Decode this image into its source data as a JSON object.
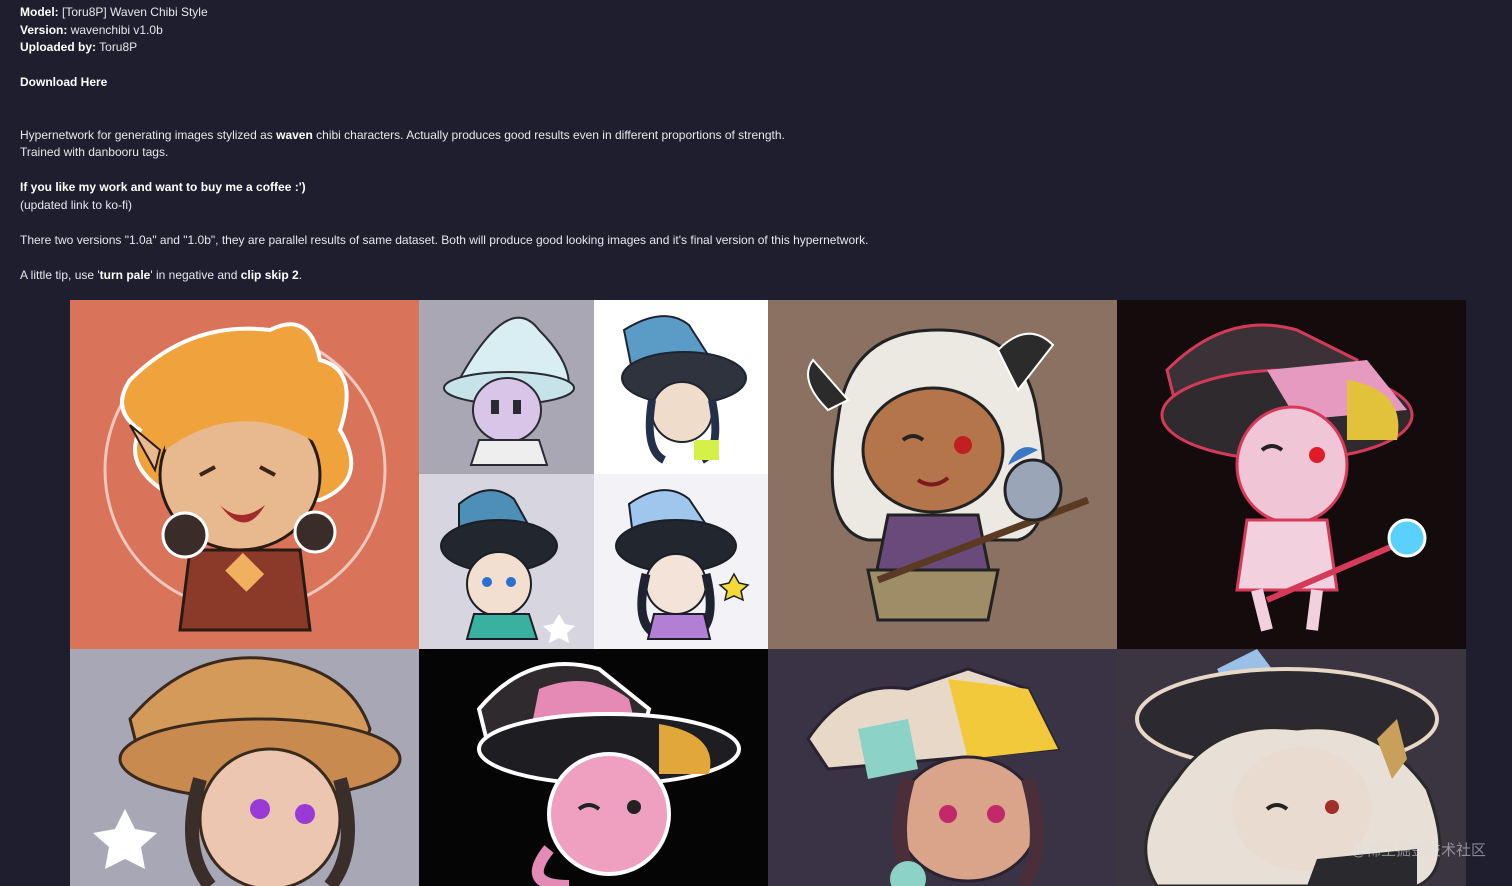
{
  "model": {
    "label": "Model:",
    "value": "[Toru8P] Waven Chibi Style"
  },
  "version": {
    "label": "Version:",
    "value": "wavenchibi v1.0b"
  },
  "uploaded": {
    "label": "Uploaded by:",
    "value": "Toru8P"
  },
  "download_link": "Download Here",
  "description": {
    "part1": "Hypernetwork for generating images stylized as ",
    "bold": "waven",
    "part2": " chibi characters. Actually produces good results even in different proportions of strength.",
    "line2": "Trained with danbooru tags."
  },
  "coffee": {
    "bold": "If you like my work and want to buy me a coffee :')",
    "note": "(updated link to ko-fi)"
  },
  "versions_text": "There two versions \"1.0a\" and \"1.0b\", they are parallel results of same dataset. Both will produce good looking images and it's final version of this hypernetwork.",
  "tip": {
    "prefix": "A little tip, use '",
    "bold1": "turn pale",
    "middle": "' in negative and ",
    "bold2": "clip skip 2",
    "suffix": "."
  },
  "gallery": {
    "images": [
      {
        "name": "orange-hair-elf",
        "bg": "#d9735a"
      },
      {
        "name": "witch-white-hat",
        "bg": "#a9a7b4"
      },
      {
        "name": "witch-blue-hat",
        "bg": "#ffffff"
      },
      {
        "name": "witch-dark-hat-blue",
        "bg": "#d7d6e0"
      },
      {
        "name": "witch-purple-hat",
        "bg": "#f3f3f7"
      },
      {
        "name": "white-hair-horns-bird",
        "bg": "#8a7162"
      },
      {
        "name": "pink-witch-staff",
        "bg": "#140b0c"
      },
      {
        "name": "tan-hat-elf",
        "bg": "#a8a7b5"
      },
      {
        "name": "pink-witch-black-bg",
        "bg": "#050505"
      },
      {
        "name": "yellow-hat-elf",
        "bg": "#3a3346"
      },
      {
        "name": "white-hair-witch",
        "bg": "#3b3542"
      }
    ]
  },
  "watermark": "@稀土掘金技术社区"
}
